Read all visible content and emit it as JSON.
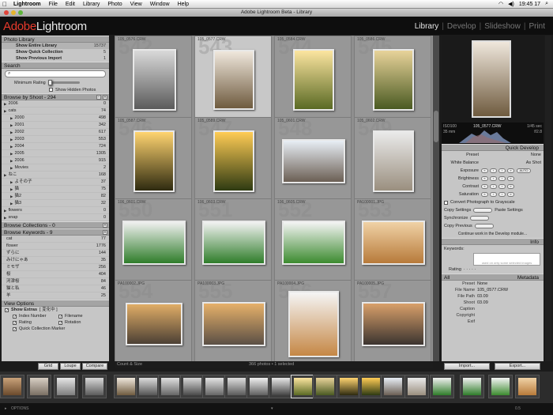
{
  "menubar": {
    "items": [
      "Lightroom",
      "File",
      "Edit",
      "Library",
      "Photo",
      "View",
      "Window",
      "Help"
    ],
    "clock": "19:45 17"
  },
  "window": {
    "title": "Adobe Lightroom Beta - Library"
  },
  "brand": {
    "adobe": "Adobe",
    "product": "Lightroom",
    "watermark": "BETA"
  },
  "modules": [
    "Library",
    "Develop",
    "Slideshow",
    "Print"
  ],
  "left": {
    "photo_library": {
      "title": "Photo Library",
      "rows": [
        {
          "label": "Show Entire Library",
          "count": "15737"
        },
        {
          "label": "Show Quick Collection",
          "count": "5"
        },
        {
          "label": "Show Previous Import",
          "count": "1"
        }
      ]
    },
    "search": {
      "title": "Search",
      "minimum_rating": "Minimum Rating",
      "show_hidden": "Show Hidden Photos"
    },
    "browse_shoot": {
      "title": "Browse by Shoot -",
      "count": "294",
      "items": [
        {
          "label": "2006",
          "count": "0",
          "indent": 0
        },
        {
          "label": "cats",
          "count": "74",
          "indent": 0
        },
        {
          "label": "2000",
          "count": "498",
          "indent": 1
        },
        {
          "label": "2001",
          "count": "342",
          "indent": 1
        },
        {
          "label": "2002",
          "count": "617",
          "indent": 1
        },
        {
          "label": "2003",
          "count": "553",
          "indent": 1
        },
        {
          "label": "2004",
          "count": "724",
          "indent": 1
        },
        {
          "label": "2005",
          "count": "1305",
          "indent": 1
        },
        {
          "label": "2006",
          "count": "915",
          "indent": 1
        },
        {
          "label": "Movies",
          "count": "2",
          "indent": 1
        },
        {
          "label": "ねこ",
          "count": "168",
          "indent": 0
        },
        {
          "label": "よその子",
          "count": "37",
          "indent": 1
        },
        {
          "label": "猫",
          "count": "75",
          "indent": 1
        },
        {
          "label": "猫2",
          "count": "82",
          "indent": 1
        },
        {
          "label": "猫3",
          "count": "32",
          "indent": 1
        },
        {
          "label": "flowers",
          "count": "0",
          "indent": 0
        },
        {
          "label": "snap",
          "count": "0",
          "indent": 0
        }
      ]
    },
    "browse_collections": {
      "title": "Browse Collections -",
      "count": "0"
    },
    "browse_keywords": {
      "title": "Browse Keywords -",
      "count": "9",
      "items": [
        {
          "label": "cat",
          "count": "77"
        },
        {
          "label": "flower",
          "count": "1776"
        },
        {
          "label": "ずらに",
          "count": "144"
        },
        {
          "label": "みけにゃあ",
          "count": "35"
        },
        {
          "label": "ミモザ",
          "count": "256"
        },
        {
          "label": "桜",
          "count": "404"
        },
        {
          "label": "河津桜",
          "count": "84"
        },
        {
          "label": "猫と私",
          "count": "46"
        },
        {
          "label": "羊",
          "count": "25"
        }
      ]
    },
    "view_options": {
      "title": "View Options",
      "show_extras": "Show Extras",
      "extras_mode": "[ 変化中 ]",
      "options": [
        "Index Number",
        "Filename",
        "Rating",
        "Rotation",
        "Quick Collection Marker"
      ]
    }
  },
  "grid": {
    "selected_index": 1,
    "cells": [
      {
        "name": "105_0576.CRW",
        "idx": "542",
        "colors": [
          "#d9d9d9",
          "#5b5b5b"
        ],
        "w": 55,
        "h": 78
      },
      {
        "name": "105_0577.CRW",
        "idx": "543",
        "colors": [
          "#efe7dc",
          "#6f5b3f"
        ],
        "w": 52,
        "h": 76
      },
      {
        "name": "105_0584.CRW",
        "idx": "544",
        "colors": [
          "#fce5a0",
          "#5a6a24"
        ],
        "w": 52,
        "h": 78
      },
      {
        "name": "105_0586.CRW",
        "idx": "545",
        "colors": [
          "#e8d39a",
          "#4a5a22"
        ],
        "w": 52,
        "h": 78
      },
      {
        "name": "105_0587.CRW",
        "idx": "546",
        "colors": [
          "#ffd470",
          "#2e2a10"
        ],
        "w": 52,
        "h": 78
      },
      {
        "name": "105_0589.CRW",
        "idx": "547",
        "colors": [
          "#ffcc55",
          "#2e3a12"
        ],
        "w": 52,
        "h": 78
      },
      {
        "name": "105_0601.CRW",
        "idx": "548",
        "colors": [
          "#e8eef5",
          "#6b5f54"
        ],
        "w": 80,
        "h": 56
      },
      {
        "name": "105_0602.CRW",
        "idx": "549",
        "colors": [
          "#eaeaea",
          "#9a8f7f"
        ],
        "w": 52,
        "h": 78
      },
      {
        "name": "106_0601.CRW",
        "idx": "550",
        "colors": [
          "#f0f0f0",
          "#2f7d2a"
        ],
        "w": 80,
        "h": 56
      },
      {
        "name": "106_0603.CRW",
        "idx": "551",
        "colors": [
          "#f2f2f2",
          "#2f7d2a"
        ],
        "w": 80,
        "h": 56
      },
      {
        "name": "106_0605.CRW",
        "idx": "552",
        "colors": [
          "#f4f4f4",
          "#3c8b2f"
        ],
        "w": 80,
        "h": 56
      },
      {
        "name": "PA100001.JPG",
        "idx": "553",
        "colors": [
          "#f0d2a6",
          "#b77a3a"
        ],
        "w": 80,
        "h": 56
      },
      {
        "name": "PA100002.JPG",
        "idx": "554",
        "colors": [
          "#e0ad67",
          "#4c4035"
        ],
        "w": 72,
        "h": 54
      },
      {
        "name": "PA100003.JPG",
        "idx": "555",
        "colors": [
          "#e6b16a",
          "#5b4f45"
        ],
        "w": 80,
        "h": 56
      },
      {
        "name": "PA100004.JPG",
        "idx": "556",
        "colors": [
          "#f5f5f5",
          "#c58745"
        ],
        "w": 64,
        "h": 84
      },
      {
        "name": "PA100005.JPG",
        "idx": "557",
        "colors": [
          "#d9a06a",
          "#3b3430"
        ],
        "w": 80,
        "h": 56
      }
    ]
  },
  "status": {
    "left": "Count & Size",
    "center": "366 photos • 1 selected"
  },
  "right": {
    "histogram": {
      "iso": "ISO100",
      "focal": "35 mm",
      "shutter": "1/45 sec",
      "aperture": "f/2.8",
      "filename": "105_0577.CRW"
    },
    "quick_develop": {
      "title": "Quick Develop",
      "preset_label": "Preset",
      "preset_value": "None",
      "white_balance_label": "White Balance",
      "white_balance_value": "As Shot",
      "controls": [
        "Exposure",
        "Brightness",
        "Contrast",
        "Saturation"
      ],
      "auto": "AUTO",
      "grayscale": "Convert Photograph to Grayscale",
      "copy_settings": "Copy Settings",
      "paste_settings": "Paste Settings",
      "synchronize": "Synchronize",
      "copy_previous": "Copy Previous",
      "continue_link": "Continue work in the Develop module..."
    },
    "info": {
      "title": "Info",
      "keywords_label": "Keywords:",
      "keywords_hint": "used on only some selected images",
      "rating_label": "Rating"
    },
    "metadata": {
      "title": "Metadata",
      "view_label": "All",
      "preset_label": "Preset",
      "preset_value": "None",
      "rows": [
        {
          "label": "File Name",
          "value": "105_0577.CRW"
        },
        {
          "label": "File Path",
          "value": "03.09"
        },
        {
          "label": "Shoot",
          "value": "03.09"
        },
        {
          "label": "Caption",
          "value": ""
        },
        {
          "label": "Copyright",
          "value": ""
        },
        {
          "label": "Exif",
          "value": ""
        }
      ]
    }
  },
  "toolbar": {
    "grid": "Grid",
    "loupe": "Loupe",
    "compare": "Compare",
    "import": "Import...",
    "export": "Export..."
  },
  "footer": {
    "options": "OPTIONS",
    "zoom": "0.5"
  }
}
